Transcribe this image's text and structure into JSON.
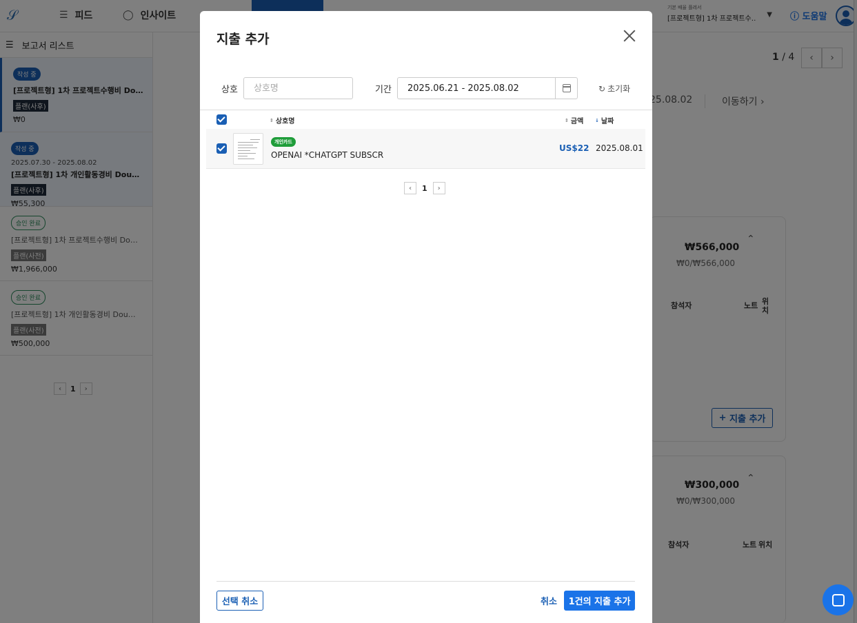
{
  "header": {
    "nav_feed": "피드",
    "nav_insight": "인사이트",
    "approver_label": "기본 배율 플레서",
    "approver_value": "[프로젝트형] 1차 프로젝트수…",
    "help": "도움말"
  },
  "sidebar": {
    "title": "보고서 리스트",
    "reports": [
      {
        "status": "작성 중",
        "date": "",
        "title": "[프로젝트형] 1차 프로젝트수행비 Do…",
        "tag": "플랜(사후)",
        "amount": "₩0"
      },
      {
        "status": "작성 중",
        "date": "2025.07.30 - 2025.08.02",
        "title": "[프로젝트형] 1차 개인활동경비 Dou…",
        "tag": "플랜(사후)",
        "amount": "₩55,300"
      },
      {
        "status": "승인 완료",
        "date": "",
        "title": "[프로젝트형] 1차 프로젝트수행비 Do…",
        "tag": "플랜(사전)",
        "amount": "₩1,966,000"
      },
      {
        "status": "승인 완료",
        "date": "",
        "title": "[프로젝트형] 1차 개인활동경비 Dou…",
        "tag": "플랜(사전)",
        "amount": "₩500,000"
      }
    ],
    "page": "1"
  },
  "main": {
    "page_current": "1",
    "page_sep": " / ",
    "page_total": "4",
    "period_end": "25.08.02",
    "move_label": "이동하기",
    "panel1": {
      "amount": "₩566,000",
      "sub": "₩0/₩566,000",
      "col_attendee": "참석자",
      "col_note": "노트",
      "col_location": "위치"
    },
    "add_expense": "지출 추가",
    "panel2": {
      "amount": "₩300,000",
      "sub": "₩0/₩300,000",
      "col_attendee": "참석자",
      "col_note": "노트",
      "col_location": "위치"
    }
  },
  "modal": {
    "title": "지출 추가",
    "merchant_label": "상호",
    "merchant_placeholder": "상호명",
    "merchant_value": "",
    "period_label": "기간",
    "period_value": "2025.06.21 - 2025.08.02",
    "reset": "초기화",
    "columns": {
      "merchant": "상호명",
      "amount": "금액",
      "date": "날짜"
    },
    "rows": [
      {
        "card_type": "개인카드",
        "merchant": "OPENAI *CHATGPT SUBSCR",
        "amount": "US$22",
        "date": "2025.08.01"
      }
    ],
    "page": "1",
    "deselect": "선택 취소",
    "cancel": "취소",
    "submit": "1건의 지출 추가"
  },
  "colors": {
    "accent": "#1a73e8",
    "card_badge": "#1f9d3a",
    "overlay": "rgba(0,0,0,0.5)"
  }
}
